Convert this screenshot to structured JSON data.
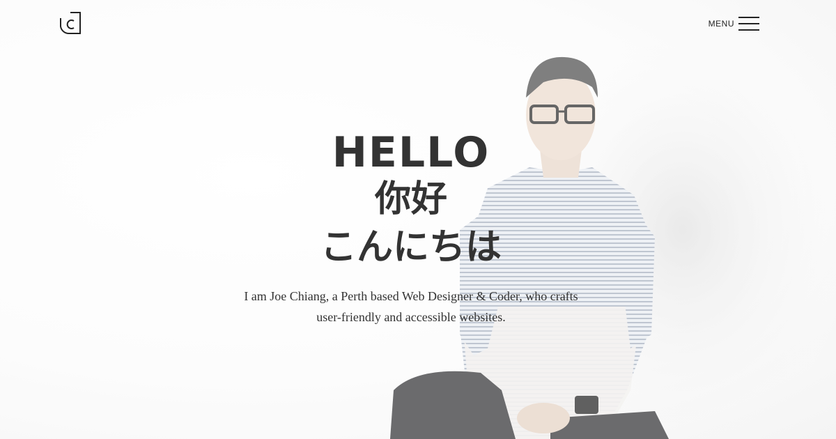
{
  "header": {
    "logo_icon": "jc-monogram-logo",
    "menu_label": "MENU",
    "menu_icon": "hamburger-icon"
  },
  "hero": {
    "greeting_en": "HELLO",
    "greeting_zh": "你好",
    "greeting_ja": "こんにちは",
    "intro_line_1": "I am Joe Chiang, a Perth based Web Designer & Coder, who crafts",
    "intro_line_2": "user-friendly and accessible websites.",
    "photo": "portrait-photo"
  },
  "colors": {
    "text": "#333333",
    "background": "#ffffff"
  }
}
